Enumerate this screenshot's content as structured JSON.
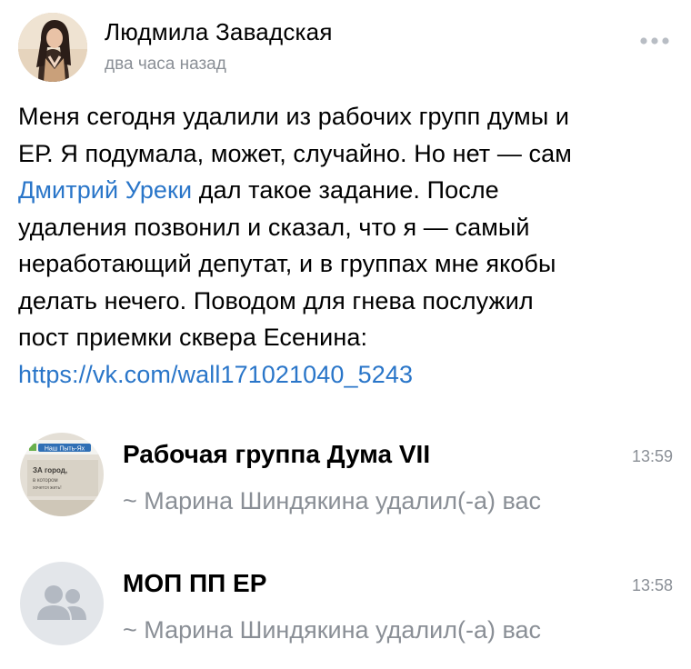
{
  "post": {
    "author": "Людмила Завадская",
    "time": "два часа назад",
    "text_lines": [
      "Меня сегодня удалили из рабочих групп думы и",
      "ЕР. Я подумала, может, случайно. Но нет — сам",
      "",
      "удаления позвонил и сказал, что я — самый",
      "неработающий депутат, и в группах мне якобы",
      "делать нечего. Поводом для гнева послужил",
      "пост приемки сквера Есенина:"
    ],
    "mention": "Дмитрий Уреки",
    "after_mention": " дал такое задание. После",
    "link": "https://vk.com/wall171021040_5243",
    "more_icon": "more-horizontal-icon"
  },
  "chats": [
    {
      "title": "Рабочая группа Дума VII",
      "time": "13:59",
      "preview": "~ Марина Шиндякина удалил(-а) вас",
      "avatar_text": [
        "Наш Пыть-Ях",
        "ЗА город,",
        "в котором",
        "хочется жить!"
      ],
      "avatar_icon": "group-photo-icon"
    },
    {
      "title": "МОП ПП ЕР",
      "time": "13:58",
      "preview": "~ Марина Шиндякина удалил(-а) вас",
      "avatar_icon": "group-placeholder-icon"
    }
  ],
  "colors": {
    "link": "#2a76c9",
    "secondary_text": "#8a8f96",
    "placeholder_avatar_bg": "#e3e6ea",
    "placeholder_avatar_icon": "#b3b9c2"
  }
}
